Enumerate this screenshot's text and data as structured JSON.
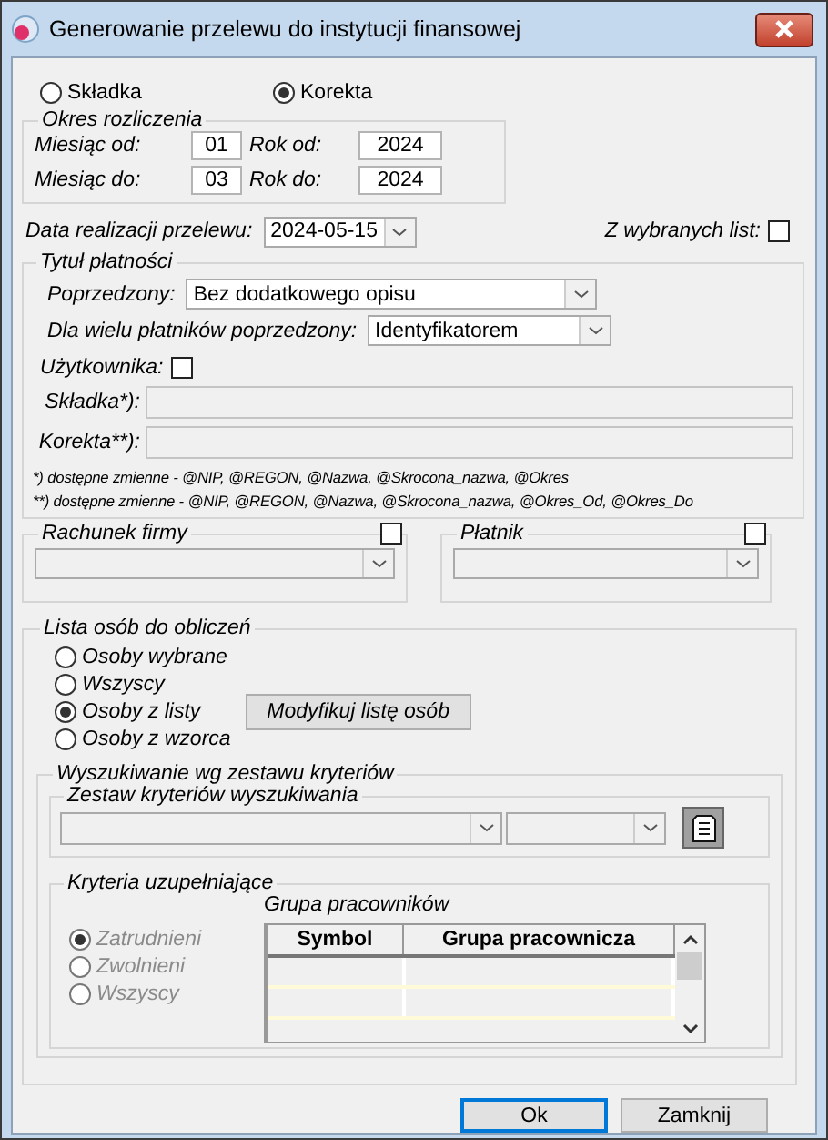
{
  "window": {
    "title": "Generowanie przelewu do instytucji finansowej"
  },
  "type_options": [
    {
      "label": "Składka",
      "selected": false
    },
    {
      "label": "Korekta",
      "selected": true
    }
  ],
  "period": {
    "title": "Okres rozliczenia",
    "fields": [
      {
        "label": "Miesiąc od:",
        "value": "01"
      },
      {
        "label": "Rok od:",
        "value": "2024"
      },
      {
        "label": "Miesiąc do:",
        "value": "03"
      },
      {
        "label": "Rok do:",
        "value": "2024"
      }
    ]
  },
  "date": {
    "label": "Data realizacji przelewu:",
    "value": "2024-05-15"
  },
  "from_lists": {
    "label": "Z wybranych list:",
    "checked": false
  },
  "payment_title": {
    "title": "Tytuł płatności",
    "preceded": {
      "label": "Poprzedzony:",
      "value": "Bez dodatkowego opisu"
    },
    "multi": {
      "label": "Dla wielu płatników poprzedzony:",
      "value": "Identyfikatorem"
    },
    "user": {
      "label": "Użytkownika:",
      "checked": false
    },
    "fields": [
      {
        "label": "Składka*):"
      },
      {
        "label": "Korekta**):"
      }
    ],
    "notes": [
      "*) dostępne zmienne - @NIP, @REGON, @Nazwa, @Skrocona_nazwa, @Okres",
      "**) dostępne zmienne - @NIP, @REGON, @Nazwa, @Skrocona_nazwa, @Okres_Od, @Okres_Do"
    ]
  },
  "company_account": {
    "title": "Rachunek firmy",
    "checked": false
  },
  "payer": {
    "title": "Płatnik",
    "checked": false
  },
  "person_list": {
    "title": "Lista osób do obliczeń",
    "options": [
      {
        "label": "Osoby wybrane",
        "selected": false
      },
      {
        "label": "Wszyscy",
        "selected": false
      },
      {
        "label": "Osoby z listy",
        "selected": true
      },
      {
        "label": "Osoby z wzorca",
        "selected": false
      }
    ],
    "modify_button": "Modyfikuj listę osób"
  },
  "search": {
    "title": "Wyszukiwanie wg zestawu kryteriów",
    "set_title": "Zestaw kryteriów wyszukiwania",
    "extra": {
      "title": "Kryteria uzupełniające",
      "disabled": true,
      "options": [
        {
          "label": "Zatrudnieni",
          "selected": true
        },
        {
          "label": "Zwolnieni",
          "selected": false
        },
        {
          "label": "Wszyscy",
          "selected": false
        }
      ],
      "group_title": "Grupa pracowników",
      "columns": [
        "Symbol",
        "Grupa pracownicza"
      ]
    }
  },
  "buttons": [
    {
      "label": "Ok",
      "default": true
    },
    {
      "label": "Zamknij",
      "default": false
    }
  ]
}
